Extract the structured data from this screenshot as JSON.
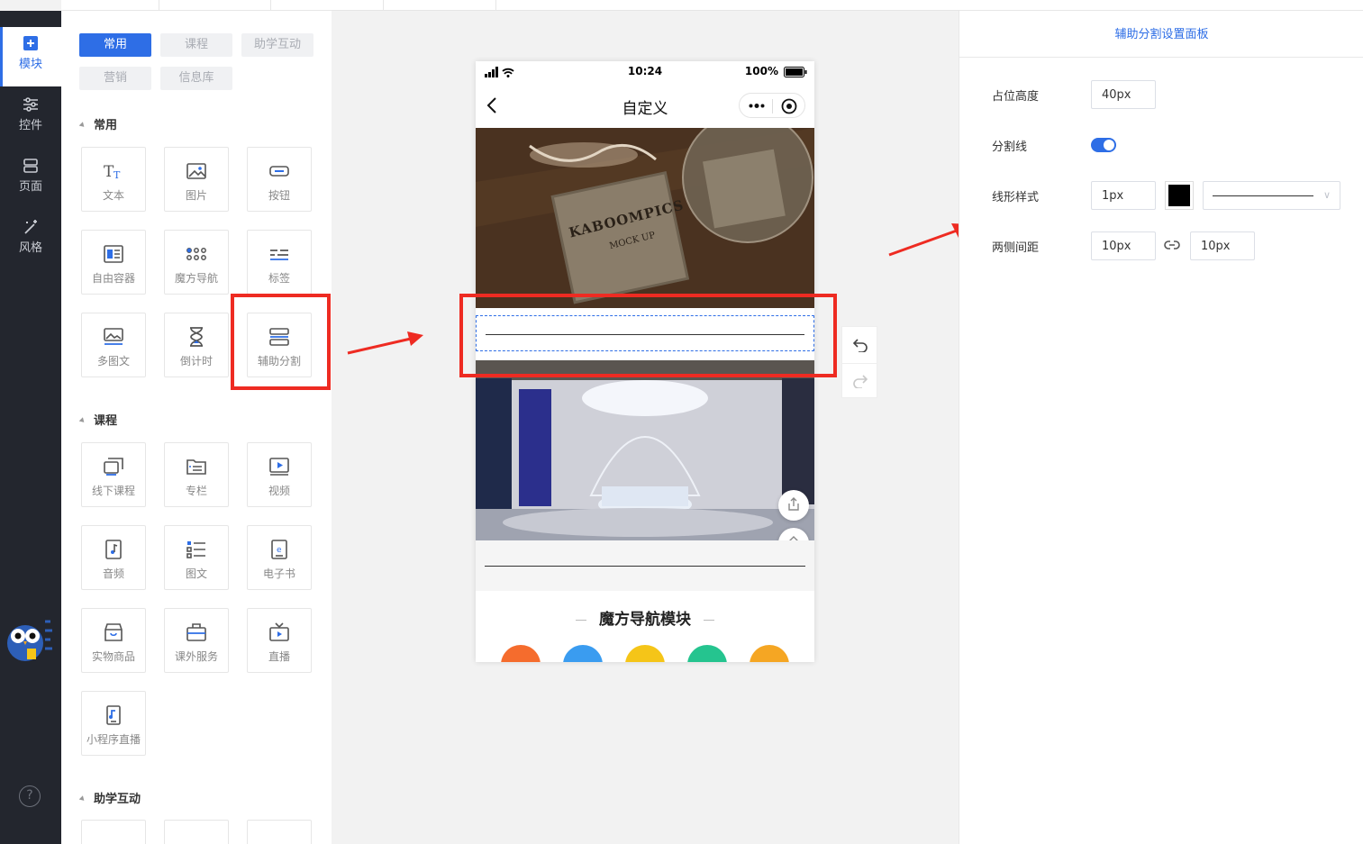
{
  "rail": {
    "items": [
      {
        "label": "模块",
        "icon": "plus-square-icon",
        "active": true
      },
      {
        "label": "控件",
        "icon": "sliders-icon"
      },
      {
        "label": "页面",
        "icon": "pages-icon"
      },
      {
        "label": "风格",
        "icon": "magic-wand-icon"
      }
    ],
    "help_glyph": "?"
  },
  "module_panel": {
    "category_chips": [
      {
        "label": "常用",
        "active": true
      },
      {
        "label": "课程"
      },
      {
        "label": "助学互动"
      },
      {
        "label": "营销"
      },
      {
        "label": "信息库"
      }
    ],
    "sections": [
      {
        "title": "常用",
        "tiles": [
          "文本",
          "图片",
          "按钮",
          "自由容器",
          "魔方导航",
          "标签",
          "多图文",
          "倒计时",
          "辅助分割"
        ]
      },
      {
        "title": "课程",
        "tiles": [
          "线下课程",
          "专栏",
          "视频",
          "音频",
          "图文",
          "电子书",
          "实物商品",
          "课外服务",
          "直播",
          "小程序直播"
        ]
      },
      {
        "title": "助学互动",
        "tiles": []
      }
    ]
  },
  "phone": {
    "status": {
      "time": "10:24",
      "battery": "100%"
    },
    "nav_title": "自定义",
    "image1_text": [
      "KABOOMPICS",
      "MOCK UP"
    ],
    "magic_nav_title": "魔方导航模块",
    "magic_nav_colors": [
      "#f56c2d",
      "#3a9cf0",
      "#f5c518",
      "#25c48f",
      "#f5a623"
    ]
  },
  "settings": {
    "title": "辅助分割设置面板",
    "height_label": "占位高度",
    "height_value": "40px",
    "divider_label": "分割线",
    "divider_enabled": true,
    "line_style_label": "线形样式",
    "line_width_value": "1px",
    "line_color": "#000000",
    "margin_label": "两侧间距",
    "margin_left_value": "10px",
    "margin_right_value": "10px"
  },
  "colors": {
    "accent": "#2e6ee6",
    "annotation_red": "#ee2b22",
    "rail_bg": "#23262e"
  }
}
